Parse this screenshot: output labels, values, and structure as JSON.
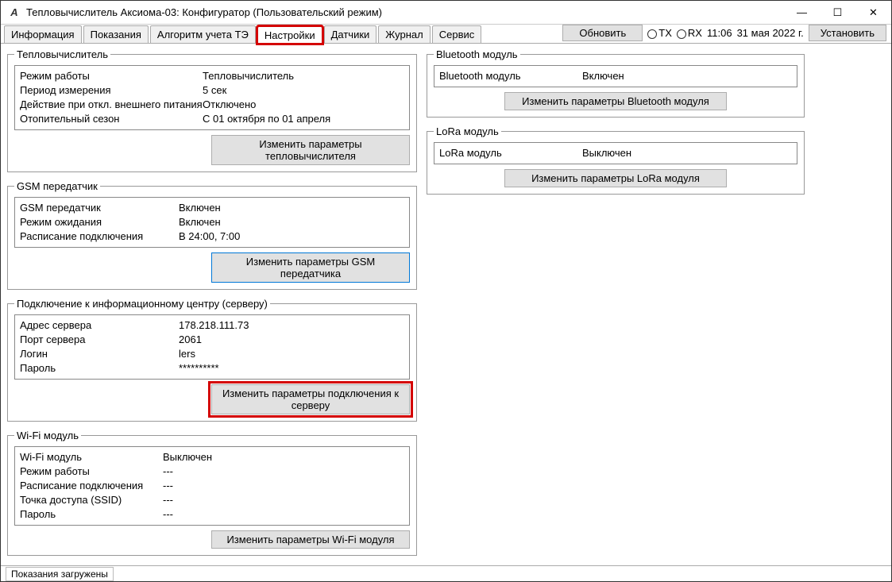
{
  "window": {
    "title": "Тепловычислитель Аксиома-03: Конфигуратор (Пользовательский режим)"
  },
  "tabs": {
    "t0": "Информация",
    "t1": "Показания",
    "t2": "Алгоритм учета ТЭ",
    "t3": "Настройки",
    "t4": "Датчики",
    "t5": "Журнал",
    "t6": "Сервис"
  },
  "toolbar": {
    "refresh": "Обновить",
    "tx": "TX",
    "rx": "RX",
    "time": "11:06",
    "date": "31 мая 2022 г.",
    "install": "Установить"
  },
  "groups": {
    "calc": {
      "legend": "Тепловычислитель",
      "r0k": "Режим работы",
      "r0v": "Тепловычислитель",
      "r1k": "Период измерения",
      "r1v": "5 сек",
      "r2k": "Действие при откл. внешнего питания",
      "r2v": "Отключено",
      "r3k": "Отопительный сезон",
      "r3v": "С 01 октября по 01 апреля",
      "btn": "Изменить параметры тепловычислителя"
    },
    "gsm": {
      "legend": "GSM передатчик",
      "r0k": "GSM передатчик",
      "r0v": "Включен",
      "r1k": "Режим ожидания",
      "r1v": "Включен",
      "r2k": "Расписание подключения",
      "r2v": "В 24:00, 7:00",
      "btn": "Изменить параметры GSM передатчика"
    },
    "server": {
      "legend": "Подключение к информационному центру (серверу)",
      "r0k": "Адрес сервера",
      "r0v": "178.218.111.73",
      "r1k": "Порт сервера",
      "r1v": "2061",
      "r2k": "Логин",
      "r2v": "lers",
      "r3k": "Пароль",
      "r3v": "**********",
      "btn": "Изменить параметры подключения к серверу"
    },
    "wifi": {
      "legend": "Wi-Fi модуль",
      "r0k": "Wi-Fi модуль",
      "r0v": "Выключен",
      "r1k": "Режим работы",
      "r1v": "---",
      "r2k": "Расписание подключения",
      "r2v": "---",
      "r3k": "Точка доступа (SSID)",
      "r3v": "---",
      "r4k": "Пароль",
      "r4v": "---",
      "btn": "Изменить параметры Wi-Fi модуля"
    },
    "bt": {
      "legend": "Bluetooth модуль",
      "r0k": "Bluetooth модуль",
      "r0v": "Включен",
      "btn": "Изменить параметры Bluetooth модуля"
    },
    "lora": {
      "legend": "LoRa модуль",
      "r0k": "LoRa модуль",
      "r0v": "Выключен",
      "btn": "Изменить параметры LoRa модуля"
    }
  },
  "status": "Показания загружены"
}
